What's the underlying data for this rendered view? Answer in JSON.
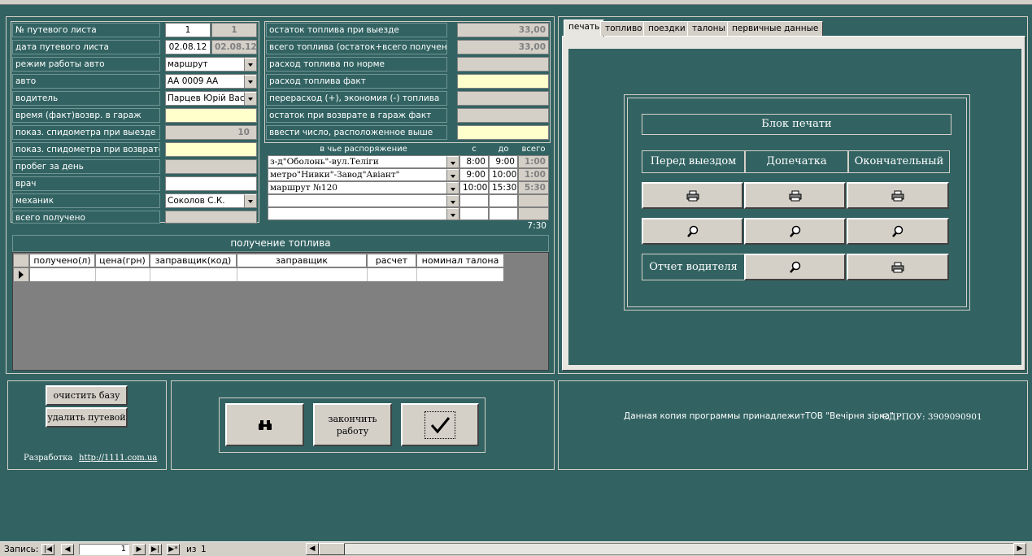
{
  "left_panel": {
    "labels": [
      "№ путевого листа",
      "дата путевого листа",
      "режим работы авто",
      "авто",
      "водитель",
      "время (факт)возвр. в гараж",
      "показ. спидометра при выезде",
      "показ. спидометра при возврате",
      "пробег за день",
      "врач",
      "механик",
      "всего получено"
    ],
    "waybill_number": "1",
    "waybill_number_ref": "1",
    "waybill_date": "02.08.12",
    "waybill_date_ref": "02.08.12",
    "mode": "маршрут",
    "car": "АА 0009 АА",
    "driver": "Парцев Юрій Васи...",
    "odometer_out": "10",
    "mechanic": "Соколов С.К."
  },
  "fuel_panel": {
    "labels": [
      "остаток топлива при выезде",
      "всего топлива (остаток+всего получено)",
      "расход топлива по норме",
      "расход топлива факт",
      "перерасход (+), экономия (-) топлива",
      "остаток при возврате в гараж  факт",
      "ввести число, расположенное выше"
    ],
    "fuel_start": "33,00",
    "fuel_total": "33,00"
  },
  "trips": {
    "headers": [
      "в чье распоряжение",
      "с",
      "до",
      "всего"
    ],
    "rows": [
      {
        "dest": "з-д\"Оболонь\"-вул.Теліги",
        "from": "8:00",
        "to": "9:00",
        "total": "1:00"
      },
      {
        "dest": "метро\"Нивки\"-Завод\"Авіант\"",
        "from": "9:00",
        "to": "10:00",
        "total": "1:00"
      },
      {
        "dest": "маршрут №120",
        "from": "10:00",
        "to": "15:30",
        "total": "5:30"
      }
    ],
    "sum": "7:30"
  },
  "fuel_receipt": {
    "title": "получение топлива",
    "columns": [
      "получено(л)",
      "цена(грн)",
      "заправщик(код)",
      "заправщик",
      "расчет",
      "номинал талона"
    ]
  },
  "tabs": [
    "печать",
    "топливо",
    "поездки",
    "талоны",
    "первичные данные"
  ],
  "print_block": {
    "title": "Блок печати",
    "col_before": "Перед выездом",
    "col_extra": "Допечатка",
    "col_final": "Окончательный",
    "driver_report": "Отчет водителя"
  },
  "bottom": {
    "clear_db": "очистить базу",
    "delete_waybill": "удалить путевой",
    "dev_label": "Разработка",
    "dev_link": "http://1111.com.ua",
    "finish_line1": "закончить",
    "finish_line2": "работу",
    "license": "Данная копия программы принадлежитТОВ \"Вечірня зірка\"",
    "edrpou": "ЄДРПОУ: 3909090901"
  },
  "status": {
    "record_label": "Запись:",
    "record_number": "1",
    "of_label": "из",
    "of_count": "1"
  },
  "colors": {
    "teal": "#326362",
    "face": "#d4d0c8",
    "yellow": "#ffffcc"
  }
}
